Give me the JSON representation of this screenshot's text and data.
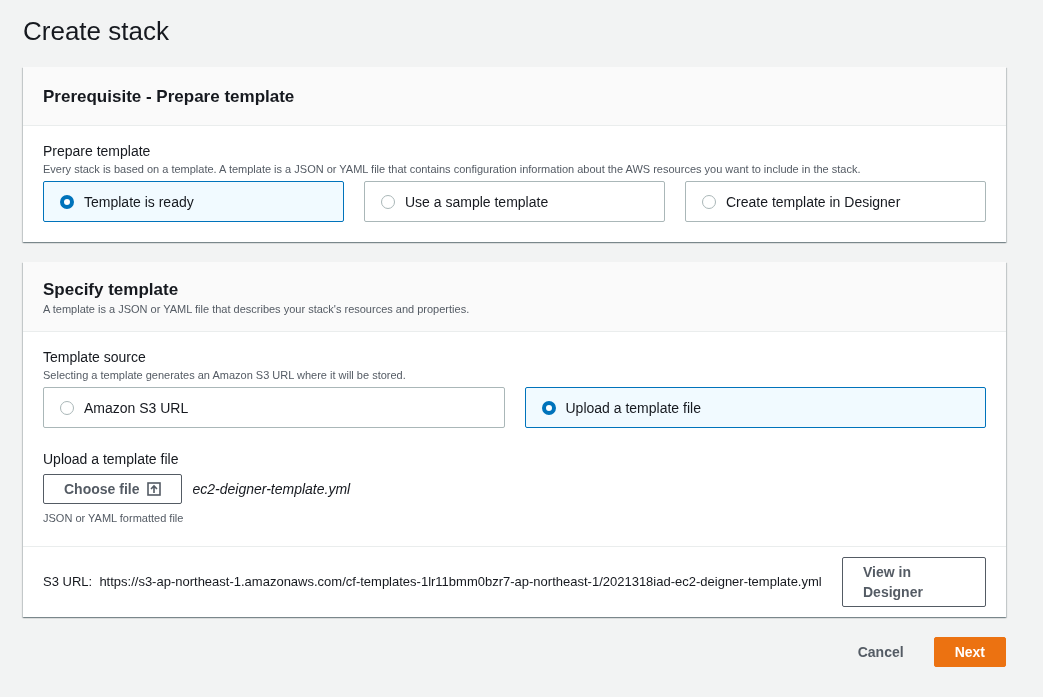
{
  "page_title": "Create stack",
  "prerequisite": {
    "title": "Prerequisite - Prepare template",
    "field_label": "Prepare template",
    "description": "Every stack is based on a template. A template is a JSON or YAML file that contains configuration information about the AWS resources you want to include in the stack.",
    "options": [
      {
        "label": "Template is ready",
        "selected": true
      },
      {
        "label": "Use a sample template",
        "selected": false
      },
      {
        "label": "Create template in Designer",
        "selected": false
      }
    ]
  },
  "specify": {
    "title": "Specify template",
    "description": "A template is a JSON or YAML file that describes your stack's resources and properties.",
    "source_label": "Template source",
    "source_description": "Selecting a template generates an Amazon S3 URL where it will be stored.",
    "sources": [
      {
        "label": "Amazon S3 URL",
        "selected": false
      },
      {
        "label": "Upload a template file",
        "selected": true
      }
    ],
    "upload_label": "Upload a template file",
    "choose_file_button": "Choose file",
    "file_name": "ec2-deigner-template.yml",
    "upload_hint": "JSON or YAML formatted file",
    "s3_url_label": "S3 URL:",
    "s3_url": "https://s3-ap-northeast-1.amazonaws.com/cf-templates-1lr11bmm0bzr7-ap-northeast-1/2021318iad-ec2-deigner-template.yml",
    "view_button": "View in Designer"
  },
  "buttons": {
    "cancel": "Cancel",
    "next": "Next"
  }
}
